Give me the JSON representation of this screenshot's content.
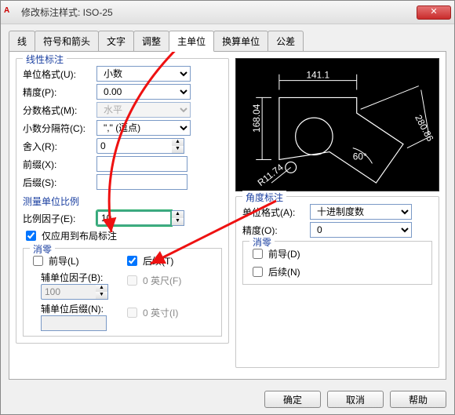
{
  "window": {
    "title": "修改标注样式: ISO-25"
  },
  "tabs": [
    "线",
    "符号和箭头",
    "文字",
    "调整",
    "主单位",
    "换算单位",
    "公差"
  ],
  "active_tab": 4,
  "linear": {
    "group": "线性标注",
    "unit_format_label": "单位格式(U):",
    "unit_format_value": "小数",
    "precision_label": "精度(P):",
    "precision_value": "0.00",
    "fraction_label": "分数格式(M):",
    "fraction_value": "水平",
    "decimal_sep_label": "小数分隔符(C):",
    "decimal_sep_value": "\",\" (逗点)",
    "roundoff_label": "舍入(R):",
    "roundoff_value": "0",
    "prefix_label": "前缀(X):",
    "prefix_value": "",
    "suffix_label": "后缀(S):",
    "suffix_value": ""
  },
  "scale": {
    "group": "测量单位比例",
    "factor_label": "比例因子(E):",
    "factor_value": "10",
    "layout_only_label": "仅应用到布局标注"
  },
  "zero": {
    "group": "消零",
    "leading_label": "前导(L)",
    "trailing_label": "后续(T)",
    "sub_factor_label": "辅单位因子(B):",
    "sub_factor_value": "100",
    "zero_feet_label": "0 英尺(F)",
    "sub_suffix_label": "辅单位后缀(N):",
    "sub_suffix_value": "",
    "zero_inches_label": "0 英寸(I)"
  },
  "angular": {
    "group": "角度标注",
    "unit_format_label": "单位格式(A):",
    "unit_format_value": "十进制度数",
    "precision_label": "精度(O):",
    "precision_value": "0",
    "zero_group": "消零",
    "leading_label": "前导(D)",
    "trailing_label": "后续(N)"
  },
  "preview": {
    "dim1": "141.1",
    "dim2": "168.04",
    "dim3": "280.86",
    "dim_r": "R11.74",
    "dim_ang": "60°"
  },
  "buttons": {
    "ok": "确定",
    "cancel": "取消",
    "help": "帮助"
  }
}
